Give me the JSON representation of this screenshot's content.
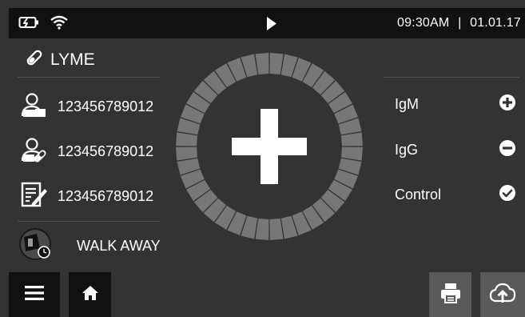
{
  "status_bar": {
    "battery_icon": "battery-charging-icon",
    "wifi_icon": "wifi-icon",
    "play_icon": "play-icon",
    "time": "09:30AM",
    "separator": "|",
    "date": "01.01.17"
  },
  "test": {
    "icon": "test-strip-icon",
    "name": "LYME"
  },
  "patient": {
    "rows": [
      {
        "icon": "patient-id-icon",
        "value": "123456789012"
      },
      {
        "icon": "operator-id-icon",
        "value": "123456789012"
      },
      {
        "icon": "sample-id-icon",
        "value": "123456789012"
      }
    ]
  },
  "result": {
    "center_symbol": "positive-plus-icon",
    "ring_segments": 40,
    "ring_color": "#777777",
    "rows": [
      {
        "label": "IgM",
        "icon": "plus-circle-icon"
      },
      {
        "label": "IgG",
        "icon": "minus-circle-icon"
      },
      {
        "label": "Control",
        "icon": "check-circle-icon"
      }
    ]
  },
  "mode": {
    "icon": "walk-away-icon",
    "label": "WALK AWAY"
  },
  "toolbar": {
    "menu_icon": "hamburger-menu-icon",
    "home_icon": "home-icon",
    "print_icon": "printer-icon",
    "upload_icon": "cloud-upload-icon"
  },
  "colors": {
    "background": "#333333",
    "bar": "#111111",
    "button_grey": "#5a5a5a",
    "text": "#ffffff"
  }
}
